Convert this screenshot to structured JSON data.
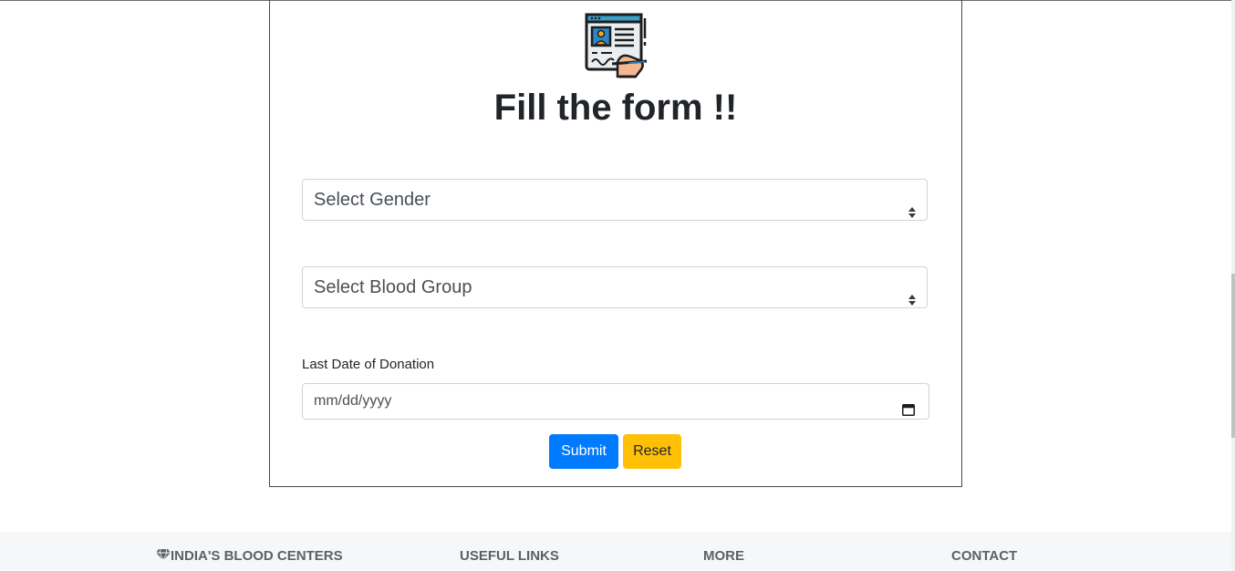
{
  "form": {
    "title": "Fill the form !!",
    "gender_select": {
      "selected": "Select Gender"
    },
    "blood_group_select": {
      "selected": "Select Blood Group"
    },
    "last_donation": {
      "label": "Last Date of Donation",
      "placeholder": "mm/dd/yyyy"
    },
    "submit_label": "Submit",
    "reset_label": "Reset"
  },
  "footer": {
    "headings": [
      "INDIA'S BLOOD CENTERS",
      "USEFUL LINKS",
      "MORE",
      "CONTACT"
    ]
  },
  "colors": {
    "primary": "#007bff",
    "warning": "#ffc107",
    "footer_bg": "#f6f7f8"
  },
  "icons": {
    "form_logo": "form-filling-icon",
    "footer_first": "gem-icon",
    "select_caret": "sort-caret-icon",
    "date_picker": "calendar-icon"
  }
}
